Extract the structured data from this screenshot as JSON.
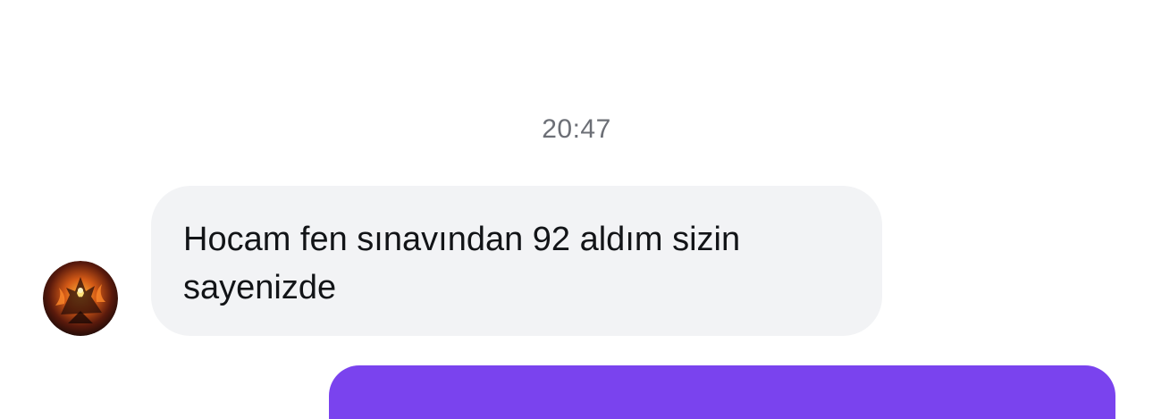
{
  "chat": {
    "timestamp": "20:47",
    "incoming_message": {
      "text": "Hocam fen sınavından 92 aldım sizin\nsayenizde",
      "avatar_icon": "contact-avatar-icon"
    },
    "outgoing_message": {
      "text": ""
    }
  },
  "colors": {
    "incoming_bubble": "#f2f3f5",
    "outgoing_bubble": "#7a43ee",
    "timestamp_text": "#6c6f76",
    "message_text": "#121417"
  }
}
